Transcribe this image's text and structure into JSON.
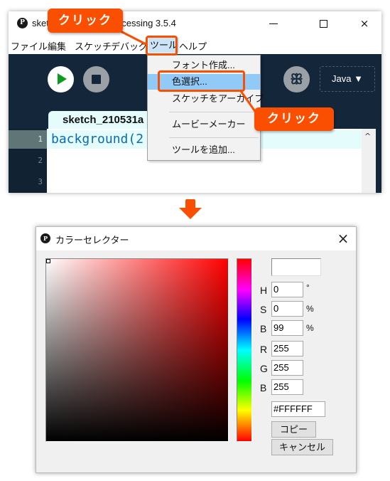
{
  "ide": {
    "app_logo": "P",
    "window_title": "sketch_210531a | Processing 3.5.4",
    "window_controls": {
      "minimize": "minimize",
      "maximize": "maximize",
      "close": "×"
    },
    "menu": [
      {
        "label": "ファイル"
      },
      {
        "label": "編集"
      },
      {
        "label": "スケッチ"
      },
      {
        "label": "デバッグ"
      },
      {
        "label": "ツール",
        "active": true
      },
      {
        "label": "ヘルプ"
      }
    ],
    "toolbar": {
      "run_icon": "play-icon",
      "stop_icon": "stop-icon",
      "debug_icon": "debugger-icon",
      "debug_glyph": "ꕥ",
      "mode_label": "Java ▼"
    },
    "tab": {
      "label": "sketch_210531a"
    },
    "editor": {
      "lines": [
        {
          "number": "1",
          "code": "background(2"
        },
        {
          "number": "2",
          "code": ""
        },
        {
          "number": "3",
          "code": ""
        }
      ],
      "scroll_up": "^"
    },
    "tools_menu": {
      "items": [
        {
          "label": "フォント作成..."
        },
        {
          "label": "色選択...",
          "highlighted": true
        },
        {
          "label": "スケッチをアーカイブ"
        },
        {
          "label": "ムービーメーカー"
        },
        {
          "label": "ツールを追加..."
        }
      ]
    }
  },
  "callouts": [
    {
      "label": "クリック",
      "target": "ツール menu"
    },
    {
      "label": "クリック",
      "target": "色選択... menu item"
    }
  ],
  "color_selector": {
    "logo": "P",
    "title": "カラーセレクター",
    "close": "×",
    "selected_color": "#FFFFFF",
    "fields": {
      "H": {
        "label": "H",
        "value": "0",
        "unit": "°"
      },
      "S": {
        "label": "S",
        "value": "0",
        "unit": "%"
      },
      "B_hsb": {
        "label": "B",
        "value": "99",
        "unit": "%"
      },
      "R": {
        "label": "R",
        "value": "255"
      },
      "G": {
        "label": "G",
        "value": "255"
      },
      "B_rgb": {
        "label": "B",
        "value": "255"
      }
    },
    "hex_value": "#FFFFFF",
    "copy_button": "コピー",
    "cancel_button": "キャンセル"
  },
  "colors": {
    "accent_orange": "#fa4f00",
    "ide_dark": "#142639",
    "menu_highlight": "#91c9f7",
    "run_green": "#0c9b1e"
  }
}
